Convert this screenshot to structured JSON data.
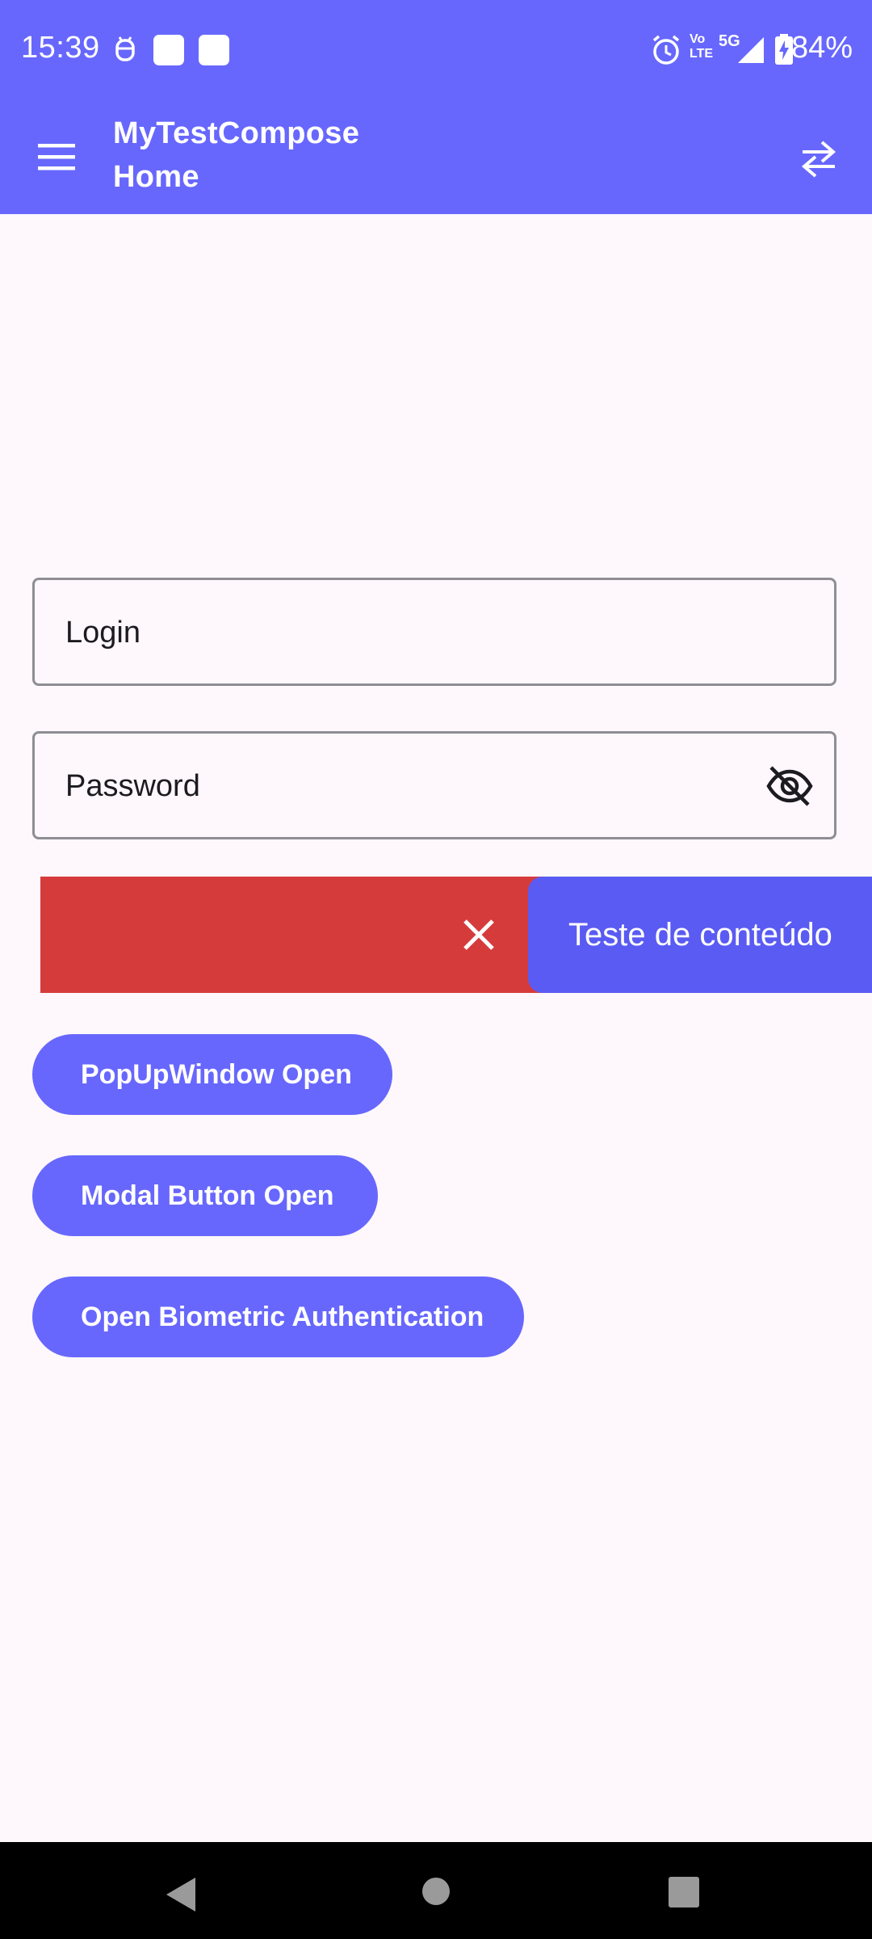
{
  "status_bar": {
    "time": "15:39",
    "network_label_top": "Vo",
    "network_label_bottom": "LTE",
    "network_5g": "5G",
    "battery_percent": "84%",
    "icons": [
      "bot-icon",
      "notification-square-icon",
      "notification-square-icon",
      "alarm-icon",
      "volte-icon",
      "signal-icon",
      "battery-charging-icon"
    ]
  },
  "app_bar": {
    "title_line1": "MyTestCompose",
    "title_line2": "Home",
    "icons": [
      "menu-icon",
      "swap-arrows-icon"
    ]
  },
  "form": {
    "login_placeholder": "Login",
    "password_placeholder": "Password",
    "password_toggle_icon": "eye-off-icon"
  },
  "swipe_item": {
    "dismiss_icon": "close-icon",
    "content_text": "Teste de conteúdo",
    "background_color": "#D63B3C",
    "card_color": "#5A5BF3"
  },
  "buttons": {
    "popup_open": "PopUpWindow Open",
    "modal_open": "Modal Button Open",
    "biometric_open": "Open Biometric Authentication"
  },
  "nav_bar": {
    "icons": [
      "back-icon",
      "home-icon",
      "recents-icon"
    ]
  },
  "colors": {
    "primary": "#6767FE",
    "background": "#FEF7FB",
    "danger": "#D63B3C"
  }
}
